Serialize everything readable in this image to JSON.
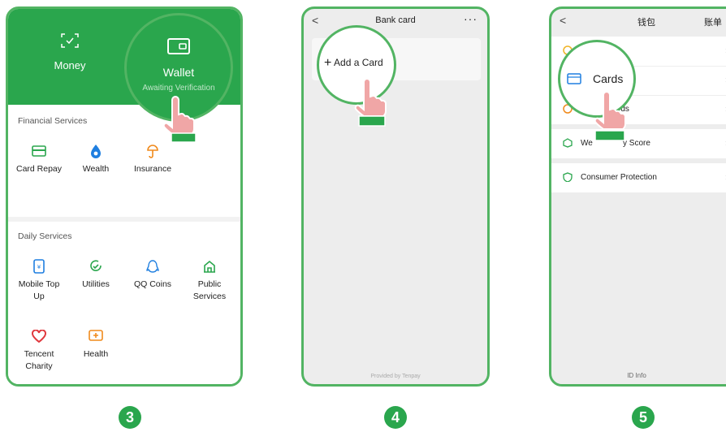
{
  "panel1": {
    "money_label": "Money",
    "wallet_label": "Wallet",
    "wallet_sub": "Awaiting Verification",
    "financial_title": "Financial Services",
    "financial_items": [
      {
        "label": "Card Repay",
        "icon": "card-icon"
      },
      {
        "label": "Wealth",
        "icon": "wealth-icon"
      },
      {
        "label": "Insurance",
        "icon": "insurance-icon"
      }
    ],
    "daily_title": "Daily Services",
    "daily_items": [
      {
        "label": "Mobile Top Up",
        "icon": "phone-icon"
      },
      {
        "label": "Utilities",
        "icon": "utilities-icon"
      },
      {
        "label": "QQ Coins",
        "icon": "qq-icon"
      },
      {
        "label": "Public Services",
        "icon": "public-services-icon"
      },
      {
        "label": "Tencent Charity",
        "icon": "charity-icon"
      },
      {
        "label": "Health",
        "icon": "health-icon"
      }
    ]
  },
  "panel2": {
    "back": "<",
    "title": "Bank card",
    "more": "···",
    "add_card": "Add a Card",
    "footer": "Provided by Tenpay"
  },
  "panel3": {
    "back": "<",
    "title": "钱包",
    "bill": "账单",
    "cards_label": "Cards",
    "cards_partial": "rds",
    "score_partial_a": "We",
    "score_partial_b": "y Score",
    "consumer_protection": "Consumer Protection",
    "id_info": "ID Info"
  },
  "steps": [
    "3",
    "4",
    "5"
  ],
  "colors": {
    "brand_green": "#2aa64d",
    "frame_green": "#52b463",
    "hand_pink": "#f0a6a6"
  }
}
